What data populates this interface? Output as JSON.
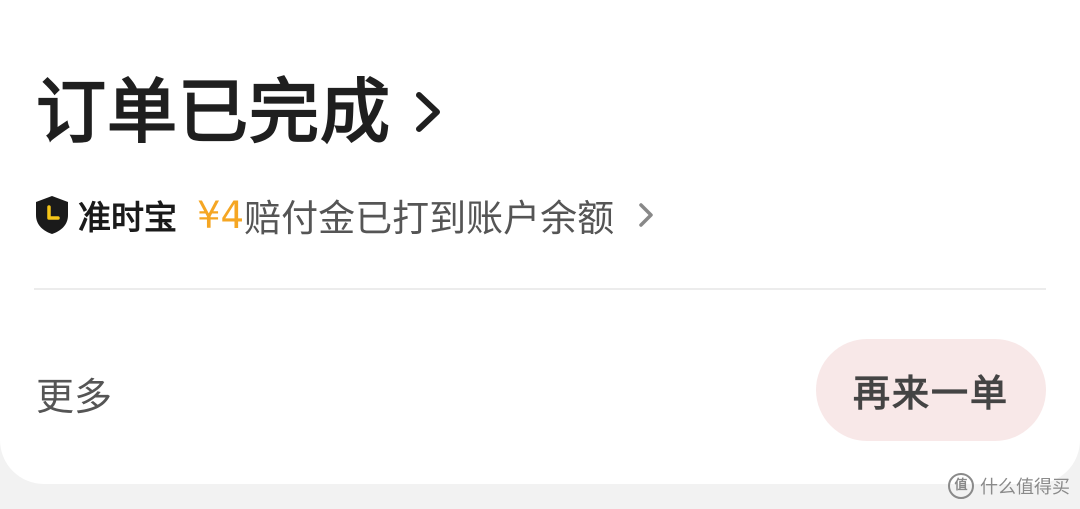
{
  "order": {
    "status_title": "订单已完成"
  },
  "punctuality": {
    "brand": "准时宝",
    "amount": "¥4",
    "message": "赔付金已打到账户余额"
  },
  "actions": {
    "more_label": "更多",
    "reorder_label": "再来一单"
  },
  "watermark": {
    "logo_char": "值",
    "text": "什么值得买"
  },
  "colors": {
    "accent_amount": "#f5a623",
    "reorder_bg": "#f8e8e8",
    "title_text": "#1f1f1f",
    "secondary_text": "#555555"
  },
  "icons": {
    "back": "chevron-left-icon",
    "title_chevron": "chevron-right-icon",
    "shield": "shield-clock-icon",
    "detail_chevron": "chevron-right-icon"
  }
}
